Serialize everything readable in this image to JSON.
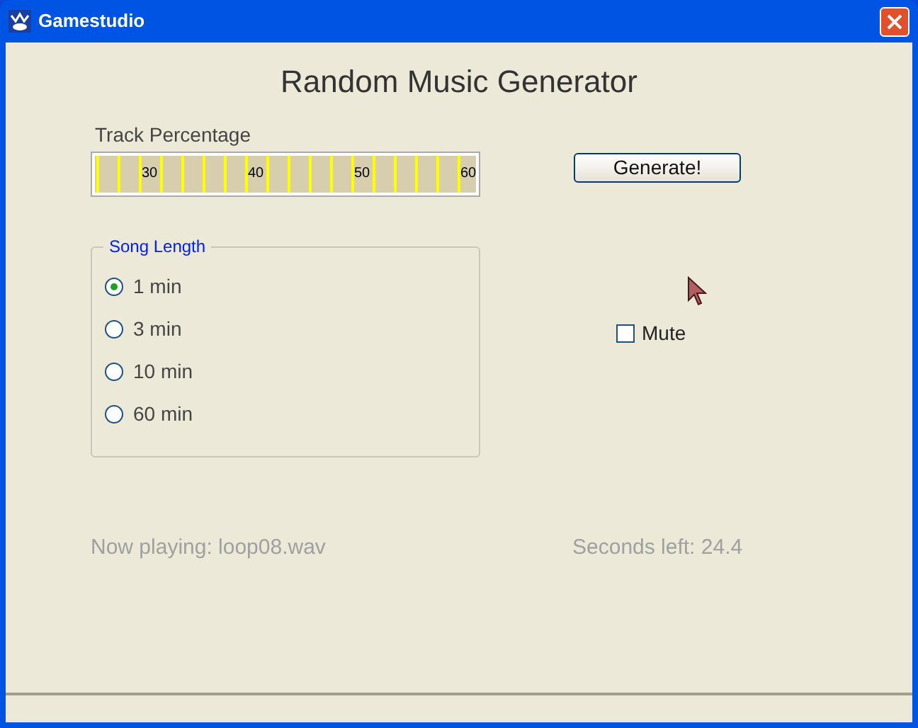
{
  "window": {
    "title": "Gamestudio"
  },
  "heading": "Random Music Generator",
  "track": {
    "label": "Track Percentage",
    "tick_labels": [
      "30",
      "40",
      "50",
      "60"
    ]
  },
  "song_length": {
    "title": "Song Length",
    "options": [
      {
        "label": "1 min",
        "selected": true
      },
      {
        "label": "3 min",
        "selected": false
      },
      {
        "label": "10 min",
        "selected": false
      },
      {
        "label": "60 min",
        "selected": false
      }
    ]
  },
  "generate_button": "Generate!",
  "mute": {
    "label": "Mute",
    "checked": false
  },
  "now_playing": "Now playing: loop08.wav",
  "seconds_left": "Seconds left: 24.4"
}
